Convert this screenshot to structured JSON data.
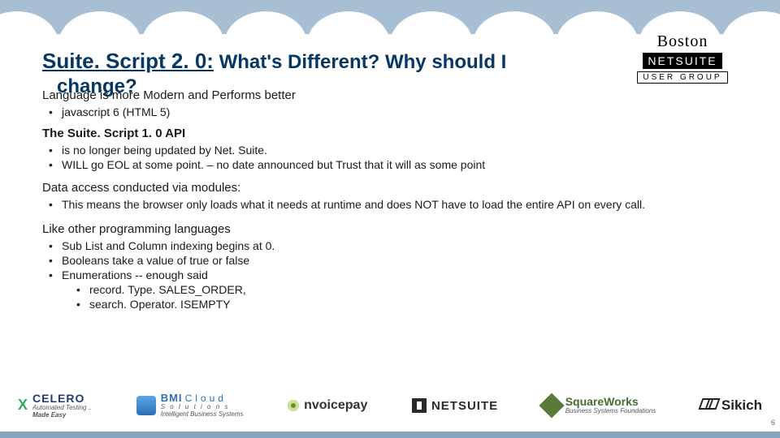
{
  "badge": {
    "line1": "Boston",
    "line2": "NETSUITE",
    "line3": "USER GROUP"
  },
  "title": {
    "prefix": "Suite. Script 2. 0:",
    "rest": " What's Different?  Why should I",
    "line2": "change?"
  },
  "sec1": {
    "lead": "Language is more Modern and Performs better",
    "b1": "javascript 6 (HTML 5)"
  },
  "sec2": {
    "head": "The Suite. Script 1. 0 API",
    "b1": "is no longer being updated by Net. Suite.",
    "b2": "WILL go EOL at some point.  – no date announced but Trust that it will as some point"
  },
  "sec3": {
    "lead": "Data access conducted via modules:",
    "b1": "This means the browser only loads what it needs at runtime and does NOT have to load the entire API on every call."
  },
  "sec4": {
    "lead": "Like other programming languages",
    "b1": "Sub List and Column indexing begins at 0.",
    "b2": "Booleans take a value of true or false",
    "b3": "Enumerations   -- enough said",
    "b3a": "record. Type. SALES_ORDER,",
    "b3b": "search. Operator. ISEMPTY"
  },
  "footer": {
    "xcelero": {
      "name": "CELERO",
      "tag1": "Automated Testing ..",
      "tag2": "Made Easy"
    },
    "bmi": {
      "name1": "BMI",
      "name2": "Cloud",
      "sub": "S o l u t i o n s",
      "tag": "Intelligent Business Systems"
    },
    "nvoice": {
      "name": "nvoicepay"
    },
    "netsuite": {
      "name": "NETSUITE"
    },
    "square": {
      "name": "SquareWorks",
      "tag": "Business Systems Foundations"
    },
    "sikich": {
      "name": "Sikich"
    },
    "page": "6"
  }
}
